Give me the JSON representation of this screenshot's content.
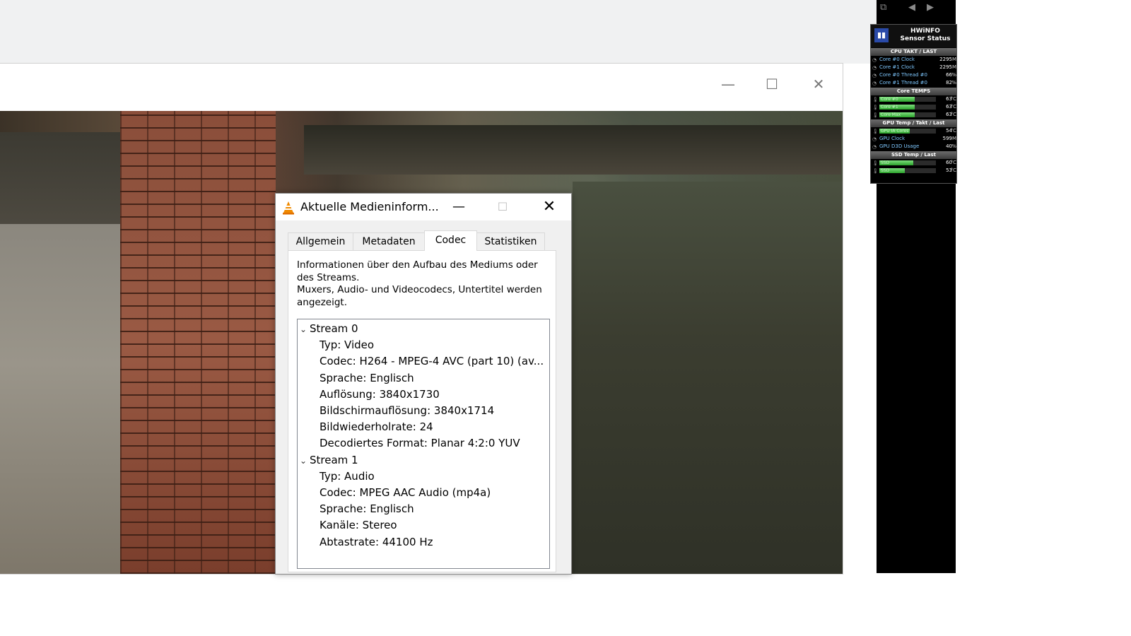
{
  "hwinfo": {
    "title_line1": "HWiNFO",
    "title_line2": "Sensor Status",
    "logo": "hwinfo-logo",
    "sections": [
      {
        "title": "CPU TAKT / LAST",
        "rows": [
          {
            "label": "Core #0 Clock",
            "value": "2295",
            "unit": "M"
          },
          {
            "label": "Core #1 Clock",
            "value": "2295",
            "unit": "M"
          },
          {
            "label": "Core #0 Thread #0",
            "value": "66",
            "unit": "%"
          },
          {
            "label": "Core #1 Thread #0",
            "value": "82",
            "unit": "%"
          }
        ]
      },
      {
        "title": "Core TEMPS",
        "rows": [
          {
            "label": "Core #0",
            "value": "63",
            "unit": "°C",
            "fill": 0.63
          },
          {
            "label": "Core #1",
            "value": "63",
            "unit": "°C",
            "fill": 0.63
          },
          {
            "label": "Core Max",
            "value": "63",
            "unit": "°C",
            "fill": 0.63
          }
        ]
      },
      {
        "title": "GPU Temp / Takt / Last",
        "rows": [
          {
            "label": "GPU IA Cores",
            "value": "54",
            "unit": "°C",
            "fill": 0.54
          },
          {
            "label": "GPU Clock",
            "value": "599",
            "unit": "M"
          },
          {
            "label": "GPU D3D Usage",
            "value": "40",
            "unit": "%"
          }
        ]
      },
      {
        "title": "SSD Temp / Last",
        "rows": [
          {
            "label": "SSD",
            "value": "60",
            "unit": "°C",
            "fill": 0.6
          },
          {
            "label": "SSD",
            "value": "53",
            "unit": "°C",
            "fill": 0.45
          }
        ]
      }
    ]
  },
  "vlc_window": {
    "controls": {
      "minimize": "—",
      "maximize": "☐",
      "close": "✕"
    }
  },
  "dialog": {
    "title": "Aktuelle Medieninform...",
    "controls": {
      "minimize": "—",
      "maximize": "☐",
      "close": "✕"
    },
    "tabs": [
      "Allgemein",
      "Metadaten",
      "Codec",
      "Statistiken"
    ],
    "active_tab": "Codec",
    "description": {
      "line1": "Informationen über den Aufbau des Mediums oder",
      "line2": "des Streams.",
      "line3": "Muxers, Audio- und Videocodecs, Untertitel werden",
      "line4": "angezeigt."
    },
    "streams": [
      {
        "label": "Stream 0",
        "items": [
          "Typ: Video",
          "Codec: H264 - MPEG-4 AVC (part 10) (av...",
          "Sprache: Englisch",
          "Auflösung: 3840x1730",
          "Bildschirmauflösung: 3840x1714",
          "Bildwiederholrate: 24",
          "Decodiertes Format: Planar 4:2:0 YUV"
        ]
      },
      {
        "label": "Stream 1",
        "items": [
          "Typ: Audio",
          "Codec: MPEG AAC Audio (mp4a)",
          "Sprache: Englisch",
          "Kanäle: Stereo",
          "Abtastrate: 44100 Hz"
        ]
      }
    ]
  }
}
